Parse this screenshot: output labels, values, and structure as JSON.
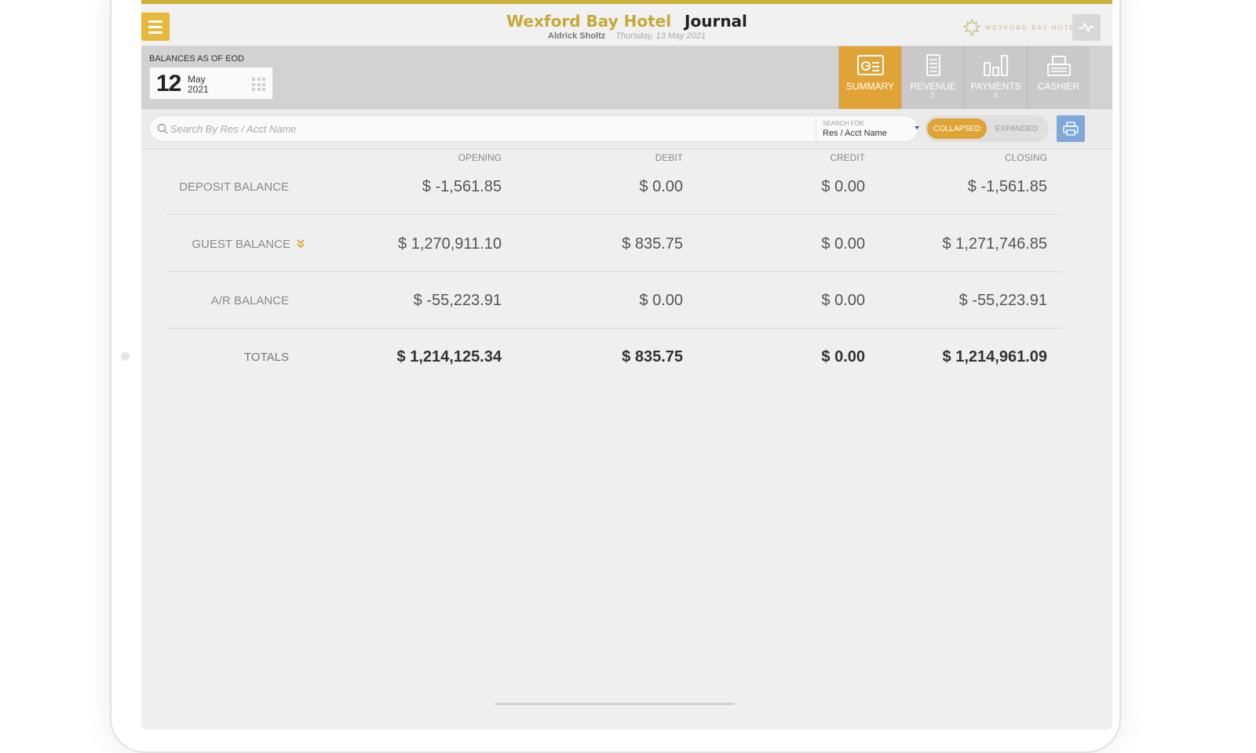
{
  "header": {
    "hotel_name": "Wexford Bay Hotel",
    "page_title": "Journal",
    "user": "Aldrick Sholtz",
    "date": "Thursday, 13 May 2021",
    "logo_text": "WEXFORD BAY HOTEL"
  },
  "balance_date": {
    "label": "BALANCES AS OF EOD",
    "day": "12",
    "month": "May",
    "year": "2021"
  },
  "tabs": [
    {
      "label": "SUMMARY",
      "sub": "",
      "active": true,
      "icon": "summary-icon"
    },
    {
      "label": "REVENUE",
      "sub": "$",
      "active": false,
      "icon": "revenue-icon"
    },
    {
      "label": "PAYMENTS",
      "sub": "$",
      "active": false,
      "icon": "payments-icon"
    },
    {
      "label": "CASHIER",
      "sub": "",
      "active": false,
      "icon": "cashier-icon"
    }
  ],
  "search": {
    "placeholder": "Search By Res / Acct Name",
    "search_for_label": "SEARCH FOR",
    "search_for_value": "Res / Acct Name"
  },
  "view_toggle": {
    "collapsed": "COLLAPSED",
    "expanded": "EXPANDED",
    "selected": "COLLAPSED"
  },
  "table": {
    "columns": [
      "OPENING",
      "DEBIT",
      "CREDIT",
      "CLOSING"
    ],
    "rows": [
      {
        "label": "DEPOSIT BALANCE",
        "opening": "$ -1,561.85",
        "debit": "$ 0.00",
        "credit": "$ 0.00",
        "closing": "$ -1,561.85"
      },
      {
        "label": "GUEST BALANCE",
        "opening": "$ 1,270,911.10",
        "debit": "$ 835.75",
        "credit": "$ 0.00",
        "closing": "$ 1,271,746.85"
      },
      {
        "label": "A/R BALANCE",
        "opening": "$ -55,223.91",
        "debit": "$ 0.00",
        "credit": "$ 0.00",
        "closing": "$ -55,223.91"
      }
    ],
    "totals": {
      "label": "TOTALS",
      "opening": "$ 1,214,125.34",
      "debit": "$ 835.75",
      "credit": "$ 0.00",
      "closing": "$ 1,214,961.09"
    }
  },
  "colors": {
    "accent": "#e0a336",
    "brand_gold": "#c6a93b",
    "print_button": "#7fa7d8"
  }
}
